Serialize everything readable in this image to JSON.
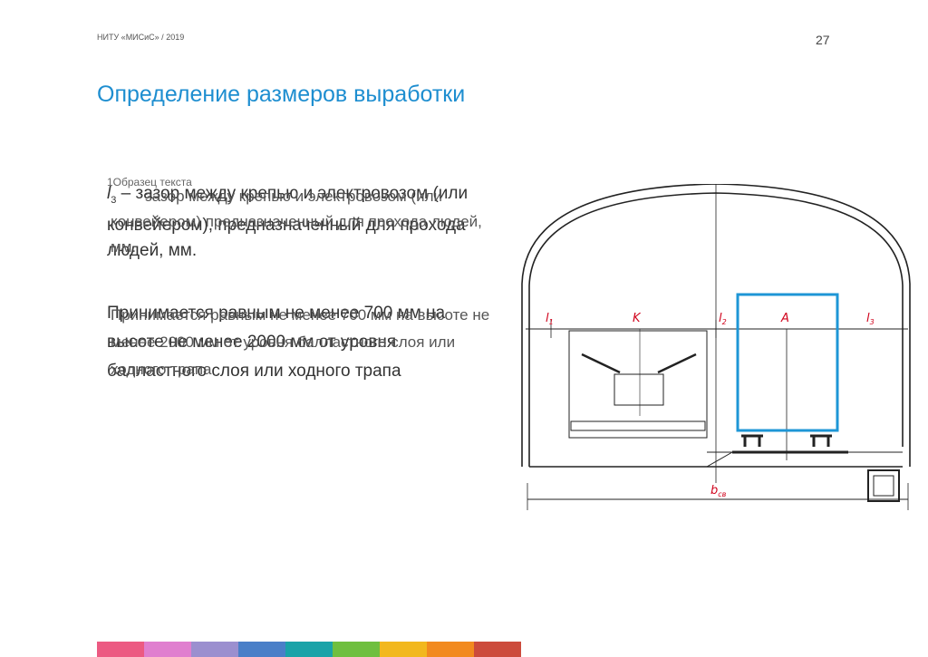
{
  "header": {
    "org": "НИТУ «МИСиС» / 2019",
    "page_number": "27"
  },
  "slide": {
    "title": "Определение размеров выработки",
    "template_text": "1Образец текста",
    "para1_symbol": "l",
    "para1_sub": "3",
    "para1_text_a": " – зазор между крепью и электровозом (или конвейером), предназначенный для прохода людей, мм.",
    "para1_text_b": "зазор между крепью и электровозом (или конвейером) предназначенный для прохода людей, мм.",
    "para2_text_a": "Принимается равным не менее 700 мм на высоте не менее 2000 мм от уровня балластного слоя или ходного трапа",
    "para2_text_b": "Принимается равным не менее 700 мм на высоте не менее 2000 мм от уровня балластного слоя или ходного трапа"
  },
  "diagram": {
    "labels": {
      "l1": "l",
      "l1_sub": "1",
      "k": "K",
      "l2": "l",
      "l2_sub": "2",
      "a": "A",
      "l3": "l",
      "l3_sub": "3",
      "b": "b",
      "b_sub": "св"
    },
    "colors": {
      "label": "#d0021b",
      "highlight": "#1e96d6",
      "line": "#222222"
    }
  },
  "footer_bar": {
    "colors": [
      "#ec5a82",
      "#e07fcf",
      "#9b8fcf",
      "#4a7fc8",
      "#1aa3a8",
      "#6fbf3f",
      "#f2b81e",
      "#f28a1f",
      "#cc4b3c"
    ]
  }
}
